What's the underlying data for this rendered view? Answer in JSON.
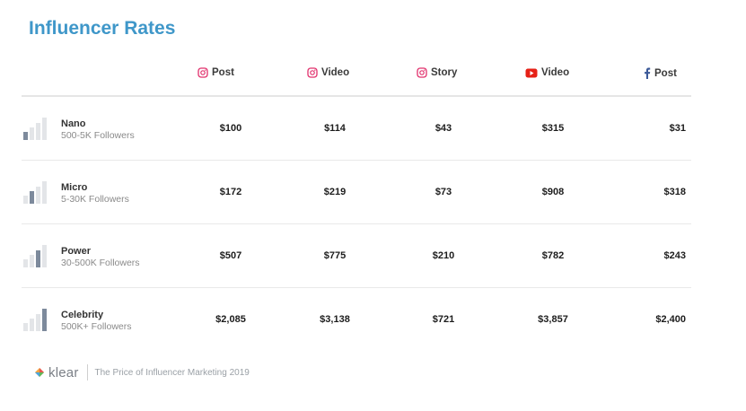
{
  "title": "Influencer Rates",
  "chart_data": {
    "type": "table",
    "columns": [
      {
        "platform": "instagram",
        "label": "Post",
        "icon": "instagram-icon",
        "color": "#e1306c"
      },
      {
        "platform": "instagram",
        "label": "Video",
        "icon": "instagram-icon",
        "color": "#e1306c"
      },
      {
        "platform": "instagram",
        "label": "Story",
        "icon": "instagram-icon",
        "color": "#e1306c"
      },
      {
        "platform": "youtube",
        "label": "Video",
        "icon": "youtube-icon",
        "color": "#e62117"
      },
      {
        "platform": "facebook",
        "label": "Post",
        "icon": "facebook-icon",
        "color": "#3b5998"
      }
    ],
    "rows": [
      {
        "tier": "Nano",
        "followers": "500-5K Followers",
        "level": 1,
        "values": [
          "$100",
          "$114",
          "$43",
          "$315",
          "$31"
        ]
      },
      {
        "tier": "Micro",
        "followers": "5-30K Followers",
        "level": 2,
        "values": [
          "$172",
          "$219",
          "$73",
          "$908",
          "$318"
        ]
      },
      {
        "tier": "Power",
        "followers": "30-500K Followers",
        "level": 3,
        "values": [
          "$507",
          "$775",
          "$210",
          "$782",
          "$243"
        ]
      },
      {
        "tier": "Celebrity",
        "followers": "500K+ Followers",
        "level": 4,
        "values": [
          "$2,085",
          "$3,138",
          "$721",
          "$3,857",
          "$2,400"
        ]
      }
    ]
  },
  "footer": {
    "brand": "klear",
    "brand_icon": "klear-logo-icon",
    "text": "The Price of Influencer Marketing 2019"
  },
  "colors": {
    "title": "#3f97c9",
    "bar_active": "#7d8a9c",
    "bar_inactive": "#e3e5e8"
  }
}
